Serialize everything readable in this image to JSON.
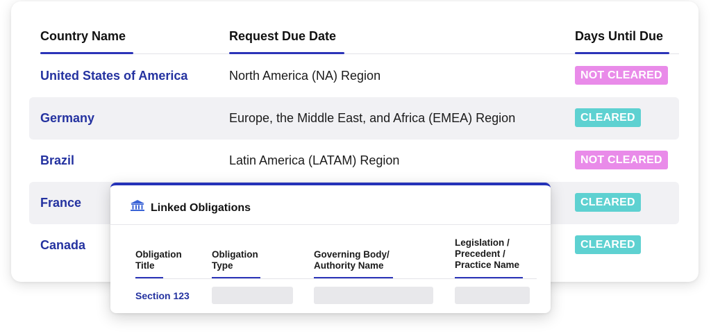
{
  "table": {
    "headers": {
      "country": "Country Name",
      "due_date": "Request Due Date",
      "days": "Days Until Due"
    },
    "rows": [
      {
        "country": "United States of America",
        "region": "North America (NA) Region",
        "status": "NOT CLEARED"
      },
      {
        "country": "Germany",
        "region": "Europe, the Middle East, and Africa (EMEA) Region",
        "status": "CLEARED"
      },
      {
        "country": "Brazil",
        "region": "Latin America (LATAM) Region",
        "status": "NOT CLEARED"
      },
      {
        "country": "France",
        "region": "",
        "status": "CLEARED"
      },
      {
        "country": "Canada",
        "region": "",
        "status": "CLEARED"
      }
    ]
  },
  "popup": {
    "icon": "bank-building-icon",
    "title": "Linked Obligations",
    "columns": {
      "title": "Obligation\nTitle",
      "type": "Obligation\nType",
      "body": "Governing Body/\nAuthority Name",
      "legislation": "Legislation /\nPrecedent /\nPractice Name"
    },
    "row": {
      "title": "Section 123"
    }
  },
  "colors": {
    "accent": "#2432a0",
    "not_cleared": "#e98be9",
    "cleared": "#5ed1d1"
  }
}
